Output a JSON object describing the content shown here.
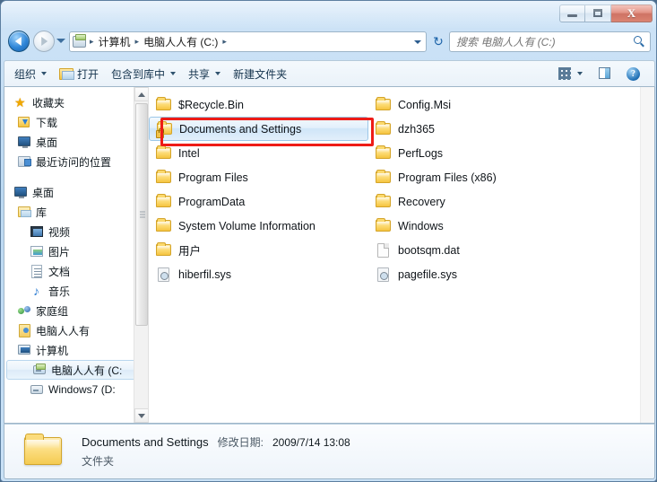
{
  "window": {
    "caption_buttons": [
      {
        "name": "minimize",
        "glyph": "minimize-icon"
      },
      {
        "name": "maximize",
        "glyph": "maximize-icon"
      },
      {
        "name": "close",
        "glyph": "close-icon",
        "label": "X"
      }
    ]
  },
  "address": {
    "back_tooltip": "后退",
    "forward_tooltip": "前进",
    "crumbs": [
      "计算机",
      "电脑人人有 (C:)"
    ],
    "separator": "▸",
    "refresh_glyph": "↻"
  },
  "search": {
    "placeholder": "搜索 电脑人人有 (C:)",
    "value": ""
  },
  "toolbar": {
    "organize": "组织",
    "open": "打开",
    "include_in_library": "包含到库中",
    "share": "共享",
    "new_folder": "新建文件夹",
    "help_label": "?"
  },
  "navpane": {
    "items": [
      {
        "label": "收藏夹",
        "icon": "star-icon",
        "level": 0,
        "selected": false
      },
      {
        "label": "下载",
        "icon": "download-folder-icon",
        "level": 1,
        "selected": false
      },
      {
        "label": "桌面",
        "icon": "desktop-icon",
        "level": 1,
        "selected": false
      },
      {
        "label": "最近访问的位置",
        "icon": "recent-places-icon",
        "level": 1,
        "selected": false
      },
      {
        "label": "桌面",
        "icon": "desktop-icon",
        "level": 0,
        "selected": false
      },
      {
        "label": "库",
        "icon": "library-icon",
        "level": 1,
        "selected": false
      },
      {
        "label": "视频",
        "icon": "video-icon",
        "level": 2,
        "selected": false
      },
      {
        "label": "图片",
        "icon": "pictures-icon",
        "level": 2,
        "selected": false
      },
      {
        "label": "文档",
        "icon": "documents-icon",
        "level": 2,
        "selected": false
      },
      {
        "label": "音乐",
        "icon": "music-icon",
        "level": 2,
        "selected": false
      },
      {
        "label": "家庭组",
        "icon": "homegroup-icon",
        "level": 1,
        "selected": false
      },
      {
        "label": "电脑人人有",
        "icon": "user-folder-icon",
        "level": 1,
        "selected": false
      },
      {
        "label": "计算机",
        "icon": "computer-icon",
        "level": 1,
        "selected": false
      },
      {
        "label": "电脑人人有 (C:",
        "icon": "system-drive-icon",
        "level": 2,
        "selected": true
      },
      {
        "label": "Windows7 (D:",
        "icon": "drive-icon",
        "level": 2,
        "selected": false
      }
    ]
  },
  "filelist": {
    "items": [
      {
        "name": "$Recycle.Bin",
        "icon": "folder-icon",
        "selected": false
      },
      {
        "name": "Documents and Settings",
        "icon": "locked-folder-icon",
        "selected": true
      },
      {
        "name": "Intel",
        "icon": "folder-icon",
        "selected": false
      },
      {
        "name": "Program Files",
        "icon": "folder-icon",
        "selected": false
      },
      {
        "name": "ProgramData",
        "icon": "folder-icon",
        "selected": false
      },
      {
        "name": "System Volume Information",
        "icon": "folder-icon",
        "selected": false
      },
      {
        "name": "用户",
        "icon": "folder-icon",
        "selected": false
      },
      {
        "name": "hiberfil.sys",
        "icon": "system-file-icon",
        "selected": false
      },
      {
        "name": "Config.Msi",
        "icon": "folder-icon",
        "selected": false
      },
      {
        "name": "dzh365",
        "icon": "folder-icon",
        "selected": false
      },
      {
        "name": "PerfLogs",
        "icon": "folder-icon",
        "selected": false
      },
      {
        "name": "Program Files (x86)",
        "icon": "folder-icon",
        "selected": false
      },
      {
        "name": "Recovery",
        "icon": "folder-icon",
        "selected": false
      },
      {
        "name": "Windows",
        "icon": "folder-icon",
        "selected": false
      },
      {
        "name": "bootsqm.dat",
        "icon": "document-file-icon",
        "selected": false
      },
      {
        "name": "pagefile.sys",
        "icon": "system-file-icon",
        "selected": false
      }
    ]
  },
  "details": {
    "name": "Documents and Settings",
    "modified_label": "修改日期:",
    "modified_value": "2009/7/14 13:08",
    "type": "文件夹"
  },
  "colors": {
    "annotation": "#ee1c17",
    "selection_border": "#9cc7e8",
    "aero_glass": "#c3e0f5"
  }
}
